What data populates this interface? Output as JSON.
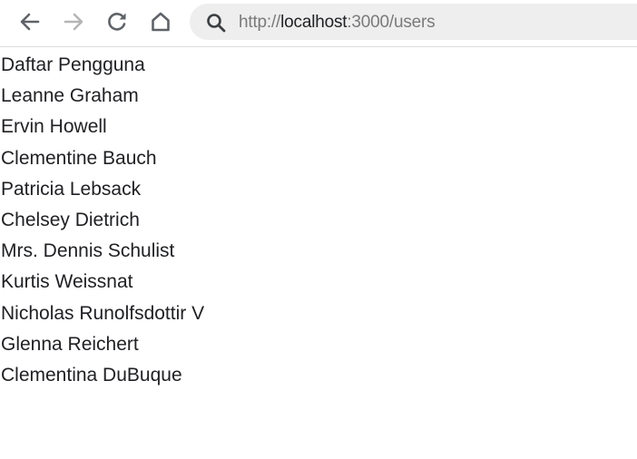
{
  "browser": {
    "url": {
      "scheme": "http://",
      "host": "localhost",
      "rest": ":3000/users"
    },
    "icons": {
      "back": "arrow-left-icon",
      "forward": "arrow-right-icon",
      "reload": "reload-icon",
      "home": "home-icon",
      "search": "search-icon"
    },
    "colors": {
      "icon_active": "#5f6368",
      "icon_disabled": "#b5b5b5",
      "omnibox_bg": "#eeeeee"
    }
  },
  "page": {
    "heading": "Daftar Pengguna",
    "users": [
      "Leanne Graham",
      "Ervin Howell",
      "Clementine Bauch",
      "Patricia Lebsack",
      "Chelsey Dietrich",
      "Mrs. Dennis Schulist",
      "Kurtis Weissnat",
      "Nicholas Runolfsdottir V",
      "Glenna Reichert",
      "Clementina DuBuque"
    ]
  }
}
